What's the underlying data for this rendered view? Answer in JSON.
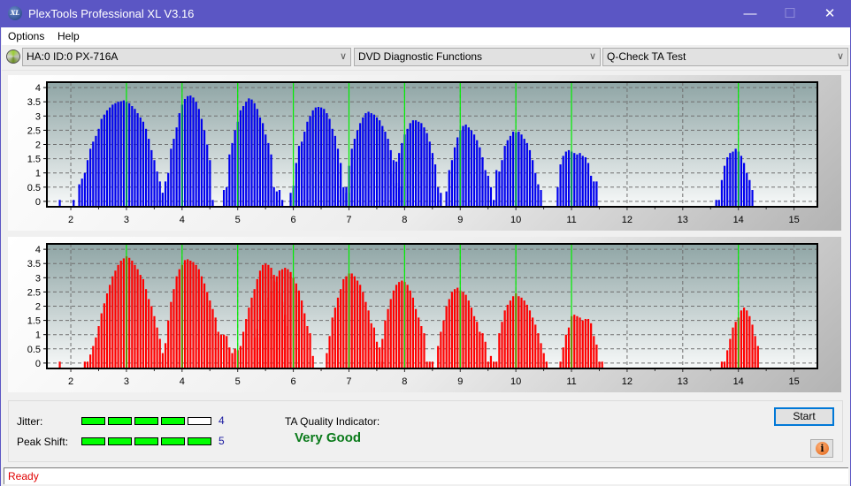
{
  "window": {
    "title": "PlexTools Professional XL V3.16",
    "logo_text": "XL",
    "minimize_icon": "—",
    "maximize_icon": "☐",
    "close_icon": "✕"
  },
  "menu": {
    "items": [
      "Options",
      "Help"
    ]
  },
  "toolbar": {
    "drive": "HA:0 ID:0  PX-716A",
    "function_group": "DVD Diagnostic Functions",
    "test": "Q-Check TA Test",
    "chevron": "∨"
  },
  "colors": {
    "blue_bars": "#0000ee",
    "red_bars": "#ff0000",
    "marker_lines": "#00ee00",
    "quality_text": "#0a7a1a",
    "status_text": "#e00000"
  },
  "chart_data": [
    {
      "type": "bar",
      "name": "lands-histogram",
      "title": "",
      "xlabel": "",
      "ylabel": "",
      "xlim": [
        1.57,
        15.42
      ],
      "ylim": [
        -0.19,
        4.19
      ],
      "x_ticks": [
        2,
        3,
        4,
        5,
        6,
        7,
        8,
        9,
        10,
        11,
        12,
        13,
        14,
        15
      ],
      "y_ticks": [
        0,
        0.5,
        1,
        1.5,
        2,
        2.5,
        3,
        3.5,
        4
      ],
      "y_tick_labels": [
        "0",
        "0.5",
        "1",
        "1.5",
        "2",
        "2.5",
        "3",
        "3.5",
        "4"
      ],
      "grid": true,
      "marker_lines": [
        3,
        4,
        5,
        6,
        7,
        8,
        9,
        10,
        11,
        14
      ],
      "bar_step": 0.05,
      "color": "#0000ee",
      "clusters": [
        {
          "x0": 1.8,
          "values": [
            0.05
          ]
        },
        {
          "x0": 2.05,
          "values": [
            0.05
          ]
        },
        {
          "x0": 2.15,
          "values": [
            0.6,
            0.8,
            1.0,
            1.45,
            1.85,
            2.1,
            2.3,
            2.55,
            2.9,
            3.05,
            3.2,
            3.3,
            3.4,
            3.45,
            3.5,
            3.52,
            3.55,
            3.5,
            3.45,
            3.35,
            3.25,
            3.1,
            2.95,
            2.8,
            2.55,
            2.2,
            1.8,
            1.45,
            1.05,
            0.7,
            0.3
          ]
        },
        {
          "x0": 3.65,
          "values": [
            0.3,
            0.7,
            1.0,
            1.85,
            2.2,
            2.6,
            3.1,
            3.4,
            3.6,
            3.7,
            3.72,
            3.65,
            3.5,
            3.25,
            2.9,
            2.5,
            2.0,
            1.45,
            0.05
          ]
        },
        {
          "x0": 4.75,
          "values": [
            0.4,
            0.5,
            1.65,
            2.05,
            2.5,
            2.8,
            3.2,
            3.35,
            3.5,
            3.62,
            3.58,
            3.45,
            3.25,
            2.95,
            2.75,
            2.35,
            2.05,
            1.65,
            0.5,
            0.35,
            0.4,
            0.05
          ]
        },
        {
          "x0": 5.95,
          "values": [
            0.3,
            0.55,
            1.35,
            1.95,
            2.1,
            2.45,
            2.8,
            3.0,
            3.2,
            3.3,
            3.32,
            3.3,
            3.25,
            3.1,
            2.9,
            2.55,
            2.3,
            1.85,
            1.35,
            0.5,
            0.3,
            0.3
          ]
        },
        {
          "x0": 6.95,
          "values": [
            0.5,
            1.25,
            1.85,
            2.2,
            2.5,
            2.75,
            2.95,
            3.1,
            3.15,
            3.1,
            3.05,
            2.95,
            2.85,
            2.65,
            2.45,
            2.2,
            1.8,
            1.45,
            0.65,
            0.5,
            0.5
          ]
        },
        {
          "x0": 7.8,
          "values": [
            1.05,
            1.4,
            1.7,
            2.05,
            2.35,
            2.55,
            2.75,
            2.85,
            2.85,
            2.8,
            2.75,
            2.6,
            2.4,
            2.1,
            1.7,
            1.3,
            0.5,
            0.3
          ]
        },
        {
          "x0": 8.75,
          "values": [
            0.35,
            1.1,
            1.45,
            1.9,
            2.25,
            2.5,
            2.65,
            2.7,
            2.6,
            2.5,
            2.35,
            2.15,
            1.9,
            1.55,
            1.1,
            0.9,
            0.5,
            0.05
          ]
        },
        {
          "x0": 9.65,
          "values": [
            1.1,
            1.05,
            1.45,
            1.95,
            2.15,
            2.3,
            2.45,
            2.42,
            2.45,
            2.35,
            2.2,
            2.05,
            1.8,
            1.45,
            1.0,
            0.6,
            0.4
          ]
        },
        {
          "x0": 10.75,
          "values": [
            0.5,
            1.3,
            1.6,
            1.75,
            1.8,
            1.75,
            1.7,
            1.65,
            1.7,
            1.6,
            1.55,
            1.35,
            0.9,
            0.7,
            0.7
          ]
        },
        {
          "x0": 13.6,
          "values": [
            0.05,
            0.05,
            0.75,
            1.25,
            1.55,
            1.7,
            1.75,
            1.85,
            1.75,
            1.6,
            1.35,
            1.0,
            0.75,
            0.4
          ]
        }
      ]
    },
    {
      "type": "bar",
      "name": "pits-histogram",
      "title": "",
      "xlabel": "",
      "ylabel": "",
      "xlim": [
        1.57,
        15.42
      ],
      "ylim": [
        -0.19,
        4.19
      ],
      "x_ticks": [
        2,
        3,
        4,
        5,
        6,
        7,
        8,
        9,
        10,
        11,
        12,
        13,
        14,
        15
      ],
      "y_ticks": [
        0,
        0.5,
        1,
        1.5,
        2,
        2.5,
        3,
        3.5,
        4
      ],
      "y_tick_labels": [
        "0",
        "0.5",
        "1",
        "1.5",
        "2",
        "2.5",
        "3",
        "3.5",
        "4"
      ],
      "grid": true,
      "marker_lines": [
        3,
        4,
        5,
        6,
        7,
        8,
        9,
        10,
        11,
        14
      ],
      "bar_step": 0.05,
      "color": "#ff0000",
      "clusters": [
        {
          "x0": 1.8,
          "values": [
            0.05
          ]
        },
        {
          "x0": 2.25,
          "values": [
            0.05,
            0.05,
            0.3,
            0.6,
            0.9,
            1.3,
            1.75,
            2.1,
            2.45,
            2.75,
            3.05,
            3.25,
            3.45,
            3.6,
            3.68,
            3.75,
            3.7,
            3.6,
            3.45,
            3.3,
            3.1,
            2.95,
            2.6,
            2.25,
            2.0,
            1.65,
            1.25,
            0.85,
            0.35
          ]
        },
        {
          "x0": 3.65,
          "values": [
            0.05,
            0.7,
            1.5,
            2.15,
            2.6,
            3.05,
            3.3,
            3.45,
            3.62,
            3.65,
            3.6,
            3.55,
            3.45,
            3.3,
            3.05,
            2.8,
            2.5,
            2.2,
            1.9,
            1.6,
            1.1,
            1.0,
            1.0,
            0.95,
            0.55,
            0.35,
            0.5,
            0.45,
            0.6,
            1.1,
            1.55,
            1.95,
            2.3,
            2.6,
            2.95,
            3.25,
            3.45,
            3.5,
            3.45,
            3.35,
            3.1,
            2.85,
            2.5,
            2.15,
            1.7,
            1.3
          ]
        },
        {
          "x0": 5.3,
          "values": [
            0.9,
            1.2,
            0.9,
            1.55,
            1.9,
            2.3,
            2.5,
            2.9,
            3.05,
            3.25,
            3.3,
            3.35,
            3.3,
            3.2,
            3.0,
            2.8,
            2.55,
            2.2,
            1.75,
            1.3,
            1.05,
            0.25
          ]
        },
        {
          "x0": 6.6,
          "values": [
            0.35,
            0.95,
            1.6,
            1.95,
            2.3,
            2.6,
            2.95,
            3.05,
            3.15,
            3.15,
            3.05,
            2.9,
            2.75,
            2.5,
            2.15,
            1.85,
            1.4,
            1.25,
            0.75,
            0.05,
            0.05
          ]
        },
        {
          "x0": 7.55,
          "values": [
            0.55,
            0.85,
            1.5,
            1.9,
            2.25,
            2.55,
            2.75,
            2.85,
            2.9,
            2.85,
            2.75,
            2.55,
            2.3,
            1.9,
            1.6,
            1.3,
            1.05,
            0.05,
            0.05,
            0.05
          ]
        },
        {
          "x0": 8.6,
          "values": [
            0.6,
            1.1,
            1.5,
            2.0,
            2.25,
            2.5,
            2.6,
            2.65,
            2.55,
            2.5,
            2.4,
            2.2,
            1.95,
            1.65,
            1.45,
            1.1,
            1.05,
            0.75,
            0.05,
            0.25,
            0.05,
            0.05
          ]
        },
        {
          "x0": 9.7,
          "values": [
            1.05,
            1.45,
            1.85,
            2.05,
            2.2,
            2.35,
            2.45,
            2.35,
            2.3,
            2.2,
            2.05,
            1.85,
            1.6,
            1.35,
            1.05,
            0.7,
            0.35,
            0.05
          ]
        },
        {
          "x0": 10.8,
          "values": [
            0.05,
            0.55,
            1.0,
            1.25,
            1.65,
            1.7,
            1.65,
            1.6,
            1.5,
            1.55,
            1.55,
            1.4,
            0.95,
            0.65,
            0.05,
            0.05
          ]
        },
        {
          "x0": 13.7,
          "values": [
            0.05,
            0.05,
            0.45,
            0.85,
            1.25,
            1.45,
            1.6,
            1.85,
            1.95,
            1.85,
            1.65,
            1.35,
            0.95,
            0.6
          ]
        }
      ]
    }
  ],
  "results": {
    "jitter_label": "Jitter:",
    "jitter_value": "4",
    "jitter_level": 4,
    "peak_shift_label": "Peak Shift:",
    "peak_shift_value": "5",
    "peak_shift_level": 5,
    "meter_max": 5,
    "ta_quality_label": "TA Quality Indicator:",
    "ta_quality_value": "Very Good"
  },
  "buttons": {
    "start": "Start",
    "info_icon": "i"
  },
  "status": {
    "text": "Ready"
  }
}
